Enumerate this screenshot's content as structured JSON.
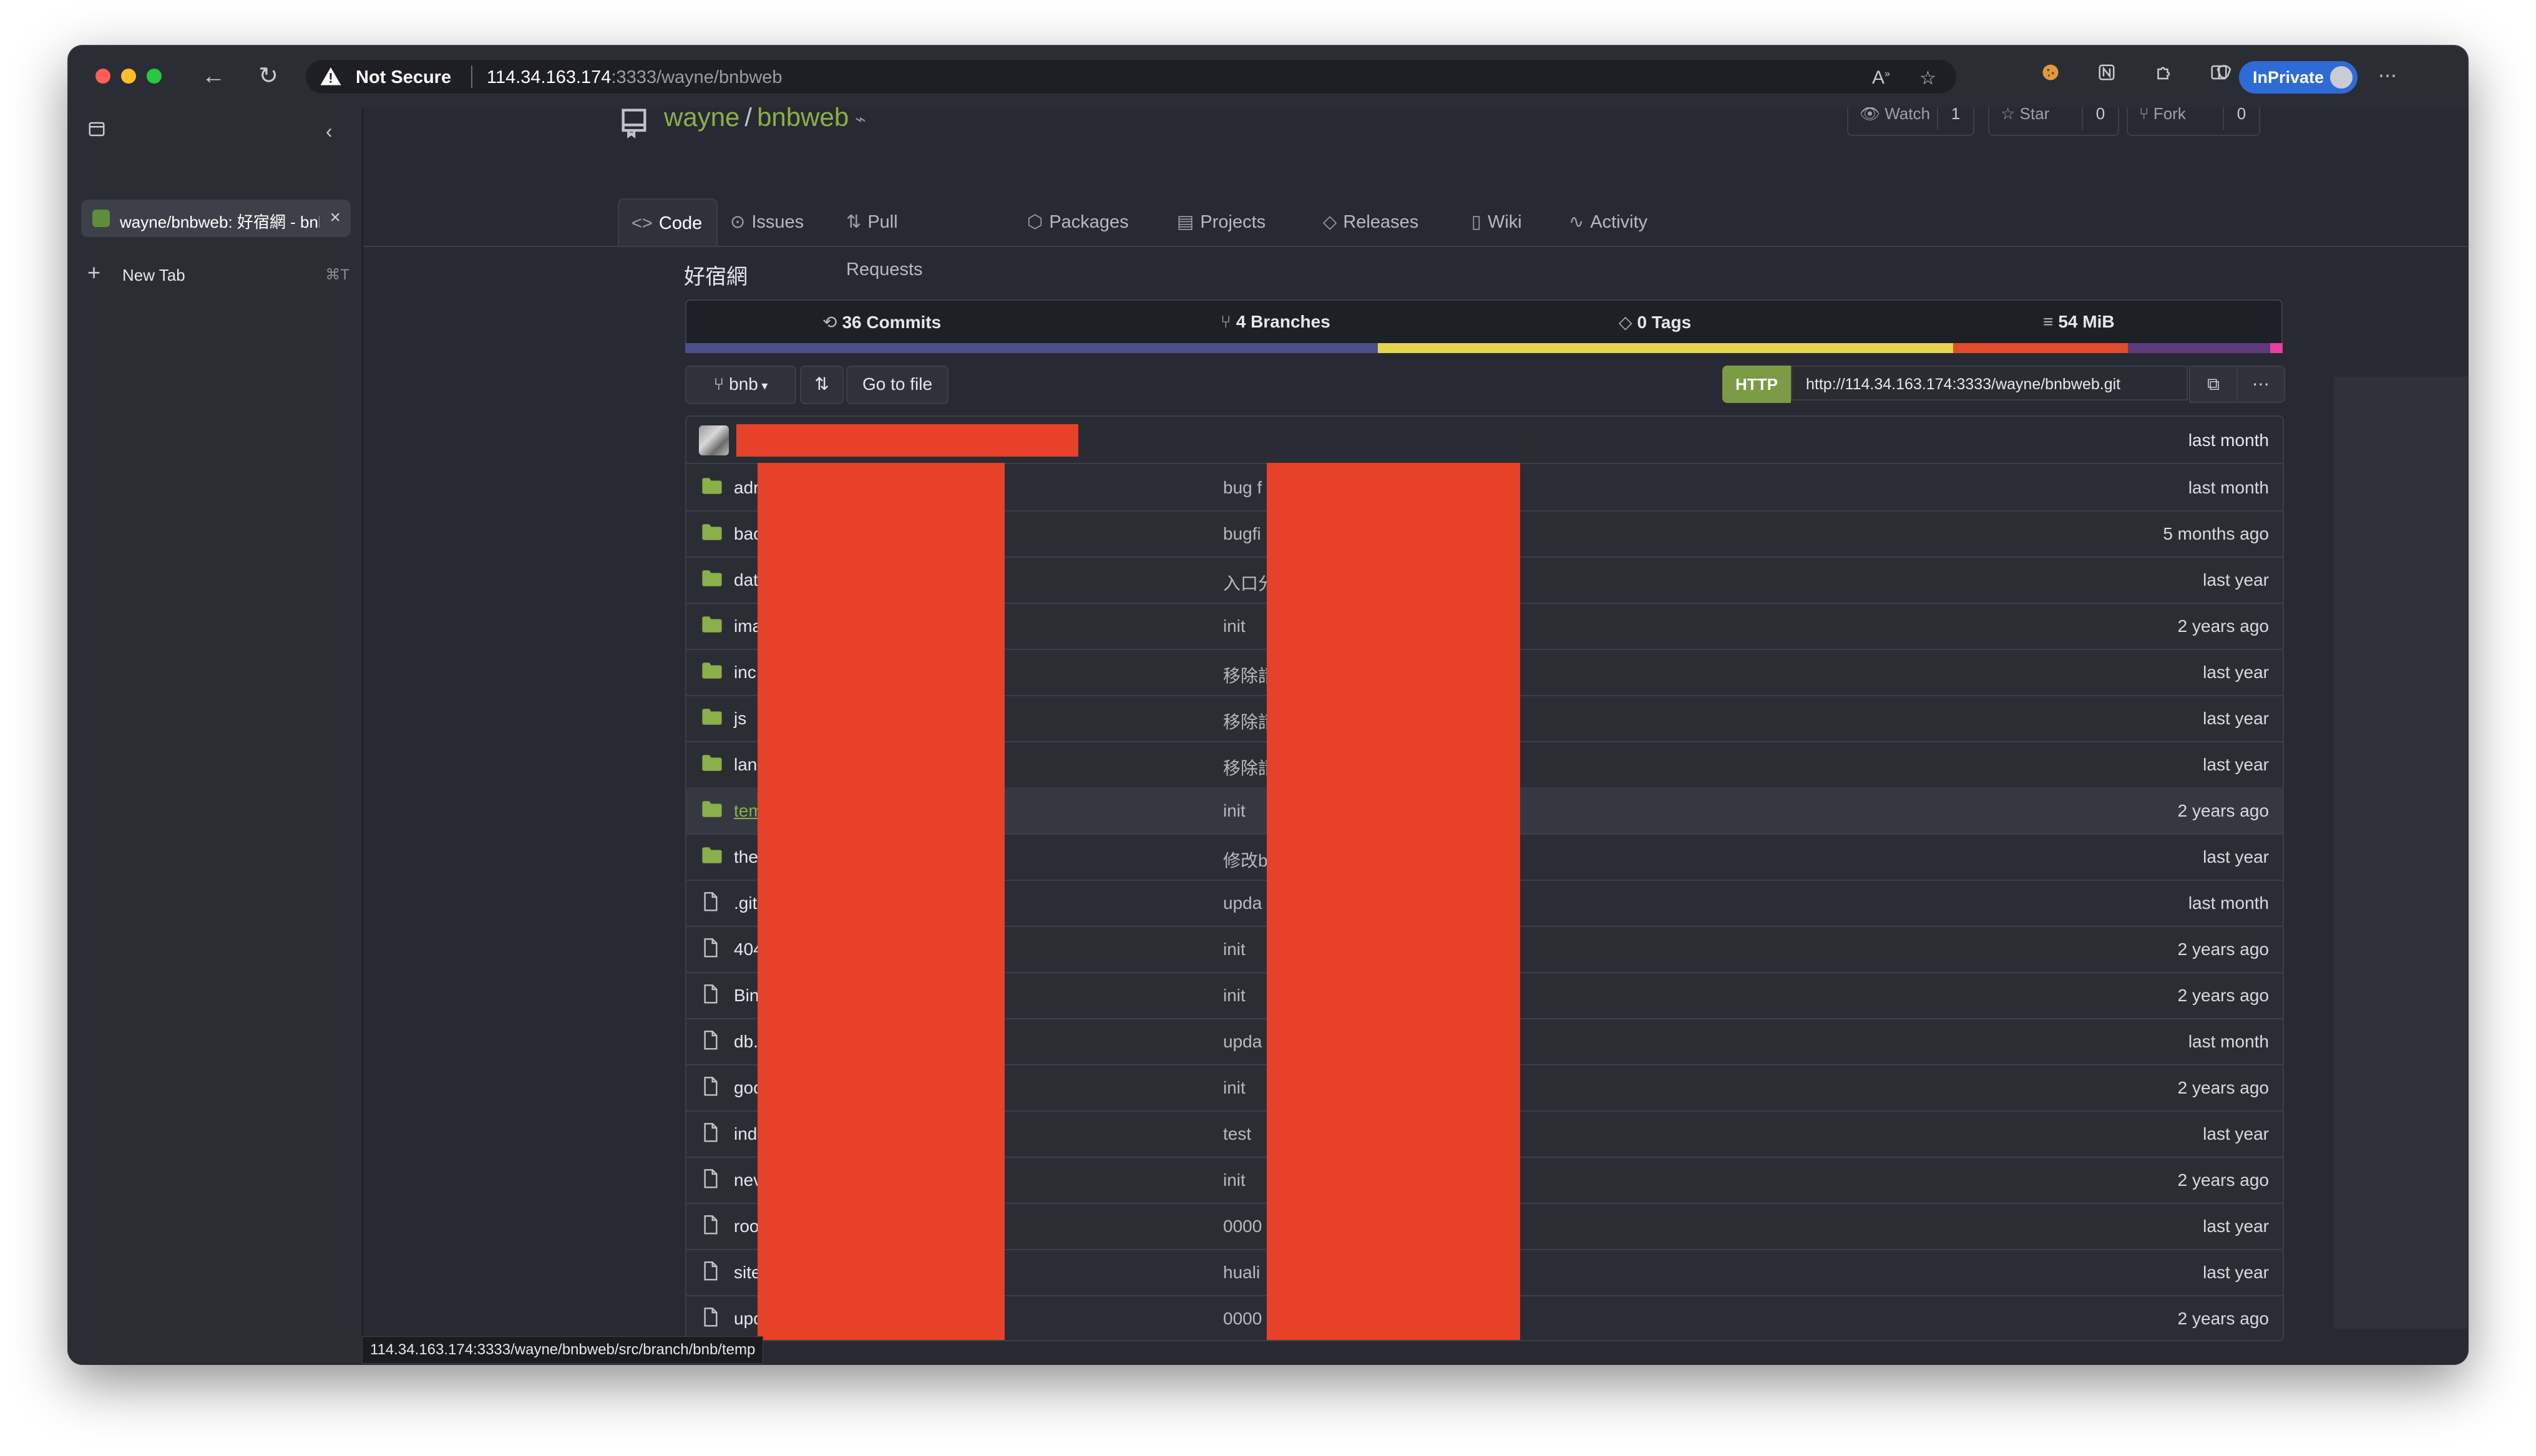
{
  "browser": {
    "security_label": "Not Secure",
    "url_host": "114.34.163.174",
    "url_path": ":3333/wayne/bnbweb",
    "inprivate_label": "InPrivate",
    "status_url": "114.34.163.174:3333/wayne/bnbweb/src/branch/bnb/temp"
  },
  "sidebar": {
    "tabs": [
      {
        "label": "wayne/bnbweb: 好宿網 - bnbweb"
      }
    ],
    "new_tab_label": "New Tab",
    "new_tab_shortcut": "⌘T"
  },
  "repo": {
    "owner": "wayne",
    "name": "bnbweb",
    "description": "好宿網",
    "actions": {
      "watch_label": "Watch",
      "watch_count": "1",
      "star_label": "Star",
      "star_count": "0",
      "fork_label": "Fork",
      "fork_count": "0"
    },
    "nav_tabs": [
      {
        "label": "Code",
        "icon": "code-icon"
      },
      {
        "label": "Issues",
        "icon": "issue-icon"
      },
      {
        "label": "Pull Requests",
        "icon": "pull-request-icon"
      },
      {
        "label": "Packages",
        "icon": "package-icon"
      },
      {
        "label": "Projects",
        "icon": "project-icon"
      },
      {
        "label": "Releases",
        "icon": "tag-icon"
      },
      {
        "label": "Wiki",
        "icon": "book-icon"
      },
      {
        "label": "Activity",
        "icon": "pulse-icon"
      }
    ],
    "stats": {
      "commits": "36 Commits",
      "branches": "4 Branches",
      "tags": "0 Tags",
      "size": "54 MiB"
    },
    "language_colors": [
      "#4a4f8a",
      "#e7d44d",
      "#e44b2a",
      "#5c3b7d",
      "#e83fa1"
    ],
    "toolbar": {
      "branch": "bnb",
      "go_to_file": "Go to file",
      "protocol": "HTTP",
      "clone_url": "http://114.34.163.174:3333/wayne/bnbweb.git"
    },
    "latest_commit_time": "last month",
    "files": [
      {
        "type": "dir",
        "name": "adr",
        "msg": "bug f",
        "time": "last month"
      },
      {
        "type": "dir",
        "name": "bac",
        "msg": "bugfi",
        "time": "5 months ago"
      },
      {
        "type": "dir",
        "name": "dat",
        "msg": "入口分",
        "time": "last year"
      },
      {
        "type": "dir",
        "name": "ima",
        "msg": "init",
        "time": "2 years ago"
      },
      {
        "type": "dir",
        "name": "inc",
        "msg": "移除請",
        "time": "last year"
      },
      {
        "type": "dir",
        "name": "js",
        "msg": "移除請",
        "time": "last year"
      },
      {
        "type": "dir",
        "name": "lan",
        "msg": "移除請",
        "time": "last year"
      },
      {
        "type": "dir",
        "name": "tem",
        "msg": "init",
        "time": "2 years ago",
        "hover": true
      },
      {
        "type": "dir",
        "name": "the",
        "msg": "修改b",
        "time": "last year"
      },
      {
        "type": "file",
        "name": ".git",
        "msg": "upda",
        "time": "last month"
      },
      {
        "type": "file",
        "name": "404",
        "msg": "init",
        "time": "2 years ago"
      },
      {
        "type": "file",
        "name": "Bin",
        "msg": "init",
        "time": "2 years ago"
      },
      {
        "type": "file",
        "name": "db.",
        "msg": "upda",
        "time": "last month"
      },
      {
        "type": "file",
        "name": "goo",
        "msg": "init",
        "time": "2 years ago"
      },
      {
        "type": "file",
        "name": "ind",
        "msg": "test",
        "time": "last year"
      },
      {
        "type": "file",
        "name": "nev",
        "msg": "init",
        "time": "2 years ago"
      },
      {
        "type": "file",
        "name": "roo",
        "msg": "0000",
        "time": "last year"
      },
      {
        "type": "file",
        "name": "site",
        "msg": "huali",
        "time": "last year"
      },
      {
        "type": "file",
        "name": "upc",
        "msg": "0000",
        "time": "2 years ago"
      }
    ]
  }
}
